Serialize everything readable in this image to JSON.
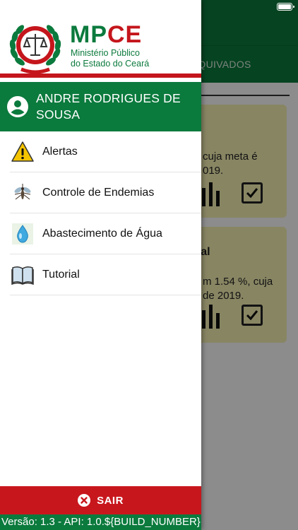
{
  "background": {
    "tab_label": "RQUIVADOS",
    "card1": {
      "text": "cuja meta é\n019."
    },
    "card2": {
      "title": "dial",
      "text": "m 1.54 %, cuja\nde 2019."
    }
  },
  "drawer": {
    "logo": {
      "title_mp": "MP",
      "title_ce": "CE",
      "subtitle_line1": "Ministério Público",
      "subtitle_line2": "do Estado do Ceará"
    },
    "user": {
      "name": "ANDRE RODRIGUES DE SOUSA"
    },
    "menu": [
      {
        "label": "Alertas",
        "icon": "warning-icon"
      },
      {
        "label": "Controle de Endemias",
        "icon": "mosquito-icon"
      },
      {
        "label": "Abastecimento de Água",
        "icon": "water-drop-icon"
      },
      {
        "label": "Tutorial",
        "icon": "book-icon"
      }
    ],
    "logout_label": "SAIR",
    "version_text": "Versão: 1.3 - API: 1.0.${BUILD_NUMBER}"
  },
  "colors": {
    "brand_green": "#0b7a3d",
    "brand_red": "#c4161c",
    "card_yellow": "#f7f3b4"
  }
}
